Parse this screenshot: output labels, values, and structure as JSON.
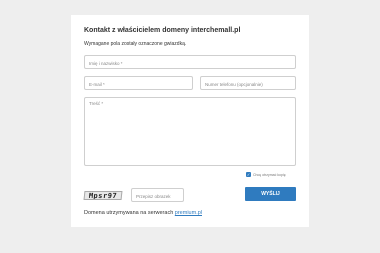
{
  "form": {
    "title": "Kontakt z właścicielem domeny interchemall.pl",
    "required_note": "Wymagane pola zostały oznaczone gwiazdką.",
    "name_placeholder": "Imię i nazwisko *",
    "email_placeholder": "E-mail *",
    "phone_placeholder": "Numer telefonu (opcjonalnie)",
    "message_placeholder": "Treść *",
    "copy_checkbox_label": "Chcę otrzymać kopię",
    "copy_checked": true,
    "captcha_text": "Mpsr97",
    "captcha_placeholder": "Przepisz obrazek",
    "send_label": "WYŚLIJ"
  },
  "footer": {
    "text": "Domena utrzymywana na serwerach ",
    "link": "premium.pl"
  },
  "colors": {
    "background": "#eeeeee",
    "card": "#ffffff",
    "accent": "#2f7bbf"
  }
}
